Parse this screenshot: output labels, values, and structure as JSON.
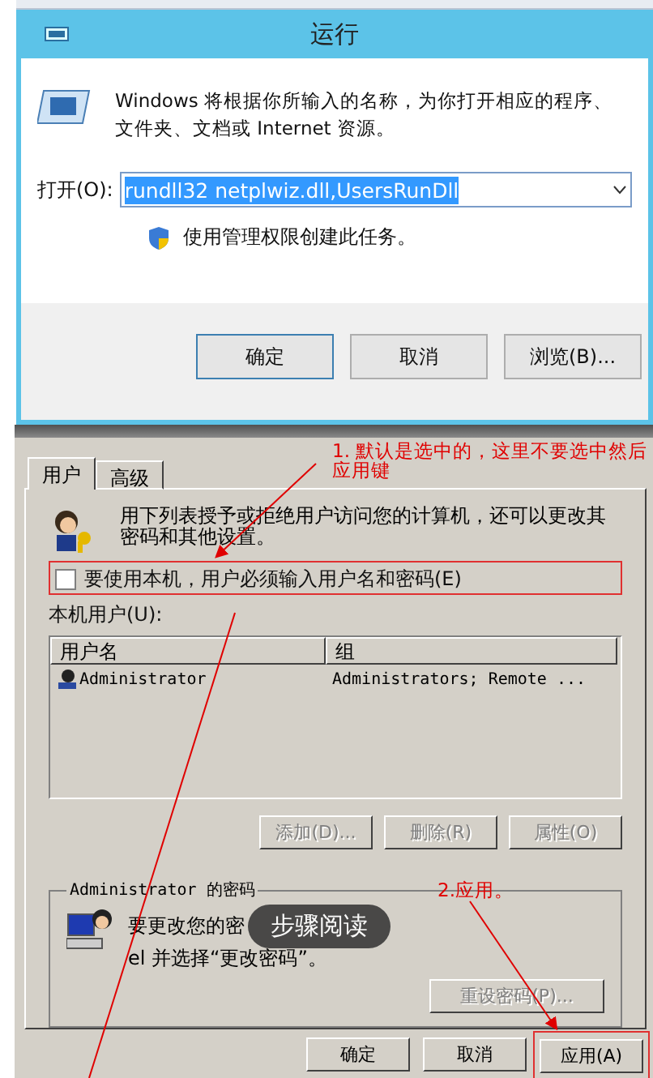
{
  "run_dialog": {
    "title": "运行",
    "description": "Windows 将根据你所输入的名称，为你打开相应的程序、文件夹、文档或 Internet 资源。",
    "open_label": "打开(O):",
    "command": "rundll32 netplwiz.dll,UsersRunDll",
    "admin_note": "使用管理权限创建此任务。",
    "buttons": [
      "确定",
      "取消",
      "浏览(B)..."
    ]
  },
  "users_dialog": {
    "tabs": [
      {
        "label": "用户",
        "selected": true
      },
      {
        "label": "高级",
        "selected": false
      }
    ],
    "description": "用下列表授予或拒绝用户访问您的计算机，还可以更改其密码和其他设置。",
    "require_login": {
      "label": "要使用本机，用户必须输入用户名和密码(E)",
      "checked": false
    },
    "list_label": "本机用户(U):",
    "table": {
      "columns": [
        "用户名",
        "组"
      ],
      "rows": [
        {
          "cells": [
            "Administrator",
            "Administrators; Remote ..."
          ]
        }
      ]
    },
    "list_buttons": [
      {
        "label": "添加(D)...",
        "disabled": true
      },
      {
        "label": "删除(R)",
        "disabled": true
      },
      {
        "label": "属性(O)",
        "disabled": true
      }
    ],
    "password_group": {
      "title": "Administrator 的密码",
      "text_before": "要更改您的密",
      "text_after": "el 并选择“更改密码”。",
      "reset_button": {
        "label": "重设密码(P)...",
        "disabled": true
      }
    },
    "footer_buttons": [
      "确定",
      "取消",
      "应用(A)"
    ]
  },
  "overlay_button": {
    "label": "步骤阅读"
  },
  "annotations": {
    "step1": [
      "1. 默认是选中的，这里不要选中然后",
      "应用键"
    ],
    "step2": "2.应用。"
  }
}
